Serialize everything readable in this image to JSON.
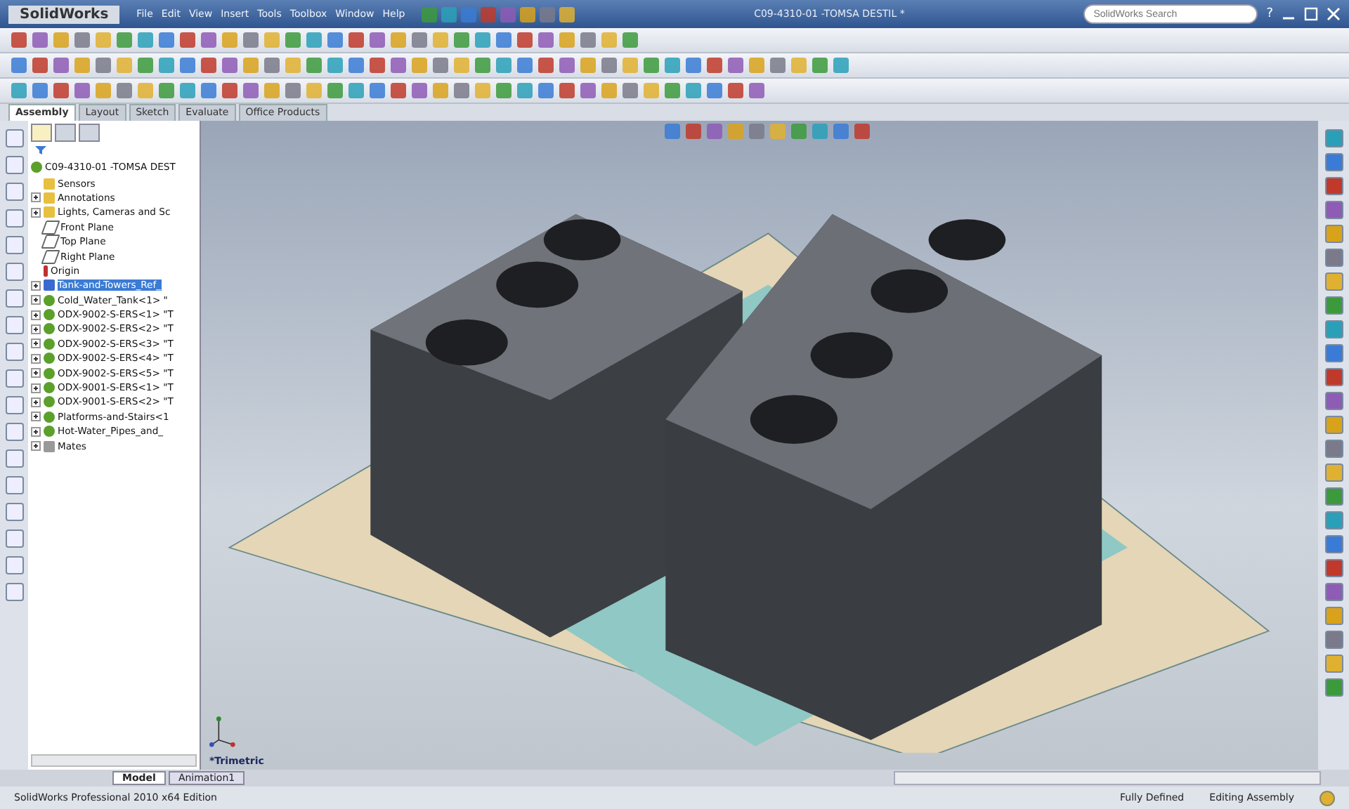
{
  "app": {
    "logo": "SolidWorks",
    "menu": [
      "File",
      "Edit",
      "View",
      "Insert",
      "Tools",
      "Toolbox",
      "Window",
      "Help"
    ],
    "title": "C09-4310-01 -TOMSA DESTIL *",
    "search": {
      "placeholder": "SolidWorks Search"
    },
    "help": "?"
  },
  "command_tabs": [
    {
      "label": "Assembly",
      "selected": true
    },
    {
      "label": "Layout",
      "selected": false
    },
    {
      "label": "Sketch",
      "selected": false
    },
    {
      "label": "Evaluate",
      "selected": false
    },
    {
      "label": "Office Products",
      "selected": false
    }
  ],
  "feature_tree": {
    "root": "C09-4310-01 -TOMSA DEST",
    "items": [
      {
        "kind": "folder",
        "label": "Sensors",
        "expandable": false,
        "selected": false
      },
      {
        "kind": "folder",
        "label": "Annotations",
        "expandable": true,
        "selected": false
      },
      {
        "kind": "folder",
        "label": "Lights, Cameras and Sc",
        "expandable": true,
        "selected": false
      },
      {
        "kind": "plane",
        "label": "Front Plane",
        "expandable": false,
        "selected": false
      },
      {
        "kind": "plane",
        "label": "Top Plane",
        "expandable": false,
        "selected": false
      },
      {
        "kind": "plane",
        "label": "Right Plane",
        "expandable": false,
        "selected": false
      },
      {
        "kind": "origin",
        "label": "Origin",
        "expandable": false,
        "selected": false
      },
      {
        "kind": "reference",
        "label": "Tank-and-Towers_Ref_",
        "expandable": true,
        "selected": true
      },
      {
        "kind": "part",
        "label": "Cold_Water_Tank<1> \"",
        "expandable": true,
        "selected": false
      },
      {
        "kind": "part",
        "label": "ODX-9002-S-ERS<1> \"T",
        "expandable": true,
        "selected": false
      },
      {
        "kind": "part",
        "label": "ODX-9002-S-ERS<2> \"T",
        "expandable": true,
        "selected": false
      },
      {
        "kind": "part",
        "label": "ODX-9002-S-ERS<3> \"T",
        "expandable": true,
        "selected": false
      },
      {
        "kind": "part",
        "label": "ODX-9002-S-ERS<4> \"T",
        "expandable": true,
        "selected": false
      },
      {
        "kind": "part",
        "label": "ODX-9002-S-ERS<5> \"T",
        "expandable": true,
        "selected": false
      },
      {
        "kind": "part",
        "label": "ODX-9001-S-ERS<1> \"T",
        "expandable": true,
        "selected": false
      },
      {
        "kind": "part",
        "label": "ODX-9001-S-ERS<2> \"T",
        "expandable": true,
        "selected": false
      },
      {
        "kind": "part",
        "label": "Platforms-and-Stairs<1",
        "expandable": true,
        "selected": false
      },
      {
        "kind": "part",
        "label": "Hot-Water_Pipes_and_",
        "expandable": true,
        "selected": false
      },
      {
        "kind": "mates",
        "label": "Mates",
        "expandable": true,
        "selected": false
      }
    ]
  },
  "viewport": {
    "view_label": "*Trimetric"
  },
  "bottom_tabs": [
    {
      "label": "Model",
      "selected": true
    },
    {
      "label": "Animation1",
      "selected": false
    }
  ],
  "status_bar": {
    "edition": "SolidWorks Professional 2010 x64 Edition",
    "state": "Fully Defined",
    "mode": "Editing Assembly"
  }
}
